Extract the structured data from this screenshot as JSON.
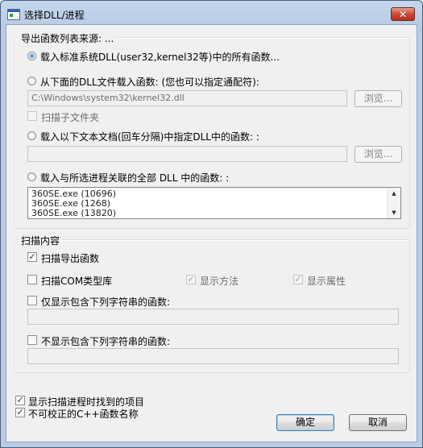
{
  "window": {
    "title": "选择DLL/进程",
    "close_glyph": "✕"
  },
  "source_group": {
    "title": "导出函数列表来源: ...",
    "option_system": "载入标准系统DLL(user32,kernel32等)中的所有函数...",
    "option_dll": "从下面的DLL文件载入函数: (您也可以指定通配符):",
    "dll_path_value": "C:\\Windows\\system32\\kernel32.dll",
    "browse_label": "浏览...",
    "scan_subfolders_label": "扫描子文件夹",
    "option_textfile": "载入以下文本文档(回车分隔)中指定DLL中的函数: :",
    "textfile_value": "",
    "option_process": "载入与所选进程关联的全部 DLL 中的函数: :",
    "process_list": [
      "360SE.exe (10696)",
      "360SE.exe (1268)",
      "360SE.exe (13820)"
    ],
    "selected_option": "system"
  },
  "scan_group": {
    "title": "扫描内容",
    "scan_exports_label": "扫描导出函数",
    "scan_exports_checked": true,
    "scan_com_label": "扫描COM类型库",
    "scan_com_checked": false,
    "show_methods_label": "显示方法",
    "show_methods_checked": true,
    "show_properties_label": "显示属性",
    "show_properties_checked": true,
    "only_include_label": "仅显示包含下列字符串的函数:",
    "only_include_checked": false,
    "only_include_value": "",
    "exclude_label": "不显示包含下列字符串的函数:",
    "exclude_checked": false,
    "exclude_value": ""
  },
  "bottom": {
    "show_found_label": "显示扫描进程时找到的项目",
    "show_found_checked": true,
    "undecorated_label": "不可校正的C++函数名称",
    "undecorated_checked": true,
    "ok_label": "确定",
    "cancel_label": "取消"
  },
  "icons": {
    "check_glyph": "✓",
    "scroll_up_glyph": "▲",
    "scroll_down_glyph": "▼"
  }
}
